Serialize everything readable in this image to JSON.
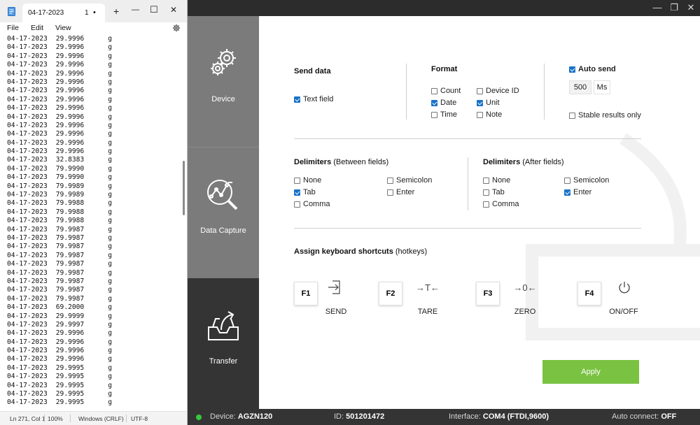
{
  "notepad": {
    "tab_title": "04-17-2023",
    "tab_number": "1",
    "tab_dot": "•",
    "new_tab": "+",
    "window_controls": {
      "minimize": "—",
      "maximize": "☐",
      "close": "✕"
    },
    "menu": {
      "file": "File",
      "edit": "Edit",
      "view": "View"
    },
    "settings_icon": "gear-icon",
    "lines": [
      [
        "04-17-2023",
        "29.9996",
        "g"
      ],
      [
        "04-17-2023",
        "29.9996",
        "g"
      ],
      [
        "04-17-2023",
        "29.9996",
        "g"
      ],
      [
        "04-17-2023",
        "29.9996",
        "g"
      ],
      [
        "04-17-2023",
        "29.9996",
        "g"
      ],
      [
        "04-17-2023",
        "29.9996",
        "g"
      ],
      [
        "04-17-2023",
        "29.9996",
        "g"
      ],
      [
        "04-17-2023",
        "29.9996",
        "g"
      ],
      [
        "04-17-2023",
        "29.9996",
        "g"
      ],
      [
        "04-17-2023",
        "29.9996",
        "g"
      ],
      [
        "04-17-2023",
        "29.9996",
        "g"
      ],
      [
        "04-17-2023",
        "29.9996",
        "g"
      ],
      [
        "04-17-2023",
        "29.9996",
        "g"
      ],
      [
        "04-17-2023",
        "29.9996",
        "g"
      ],
      [
        "04-17-2023",
        "32.8383",
        "g"
      ],
      [
        "04-17-2023",
        "79.9990",
        "g"
      ],
      [
        "04-17-2023",
        "79.9990",
        "g"
      ],
      [
        "04-17-2023",
        "79.9989",
        "g"
      ],
      [
        "04-17-2023",
        "79.9989",
        "g"
      ],
      [
        "04-17-2023",
        "79.9988",
        "g"
      ],
      [
        "04-17-2023",
        "79.9988",
        "g"
      ],
      [
        "04-17-2023",
        "79.9988",
        "g"
      ],
      [
        "04-17-2023",
        "79.9987",
        "g"
      ],
      [
        "04-17-2023",
        "79.9987",
        "g"
      ],
      [
        "04-17-2023",
        "79.9987",
        "g"
      ],
      [
        "04-17-2023",
        "79.9987",
        "g"
      ],
      [
        "04-17-2023",
        "79.9987",
        "g"
      ],
      [
        "04-17-2023",
        "79.9987",
        "g"
      ],
      [
        "04-17-2023",
        "79.9987",
        "g"
      ],
      [
        "04-17-2023",
        "79.9987",
        "g"
      ],
      [
        "04-17-2023",
        "79.9987",
        "g"
      ],
      [
        "04-17-2023",
        "69.2000",
        "g"
      ],
      [
        "04-17-2023",
        "29.9999",
        "g"
      ],
      [
        "04-17-2023",
        "29.9997",
        "g"
      ],
      [
        "04-17-2023",
        "29.9996",
        "g"
      ],
      [
        "04-17-2023",
        "29.9996",
        "g"
      ],
      [
        "04-17-2023",
        "29.9996",
        "g"
      ],
      [
        "04-17-2023",
        "29.9996",
        "g"
      ],
      [
        "04-17-2023",
        "29.9995",
        "g"
      ],
      [
        "04-17-2023",
        "29.9995",
        "g"
      ],
      [
        "04-17-2023",
        "29.9995",
        "g"
      ],
      [
        "04-17-2023",
        "29.9995",
        "g"
      ],
      [
        "04-17-2023",
        "29.9995",
        "g"
      ]
    ],
    "status": {
      "position": "Ln 271, Col 1",
      "zoom": "100%",
      "line_ending": "Windows (CRLF)",
      "encoding": "UTF-8"
    }
  },
  "app": {
    "window_controls": {
      "minimize": "—",
      "maximize": "❐",
      "close": "✕"
    },
    "sidebar": [
      {
        "label": "Device",
        "icon": "gears-icon",
        "active": true
      },
      {
        "label": "Data Capture",
        "icon": "chart-magnifier-icon",
        "active": true
      },
      {
        "label": "Transfer",
        "icon": "tray-upload-icon",
        "active": false
      }
    ],
    "send_data": {
      "title": "Send data",
      "text_field": {
        "label": "Text field",
        "checked": true
      }
    },
    "format": {
      "title": "Format",
      "options": [
        {
          "label": "Count",
          "checked": false
        },
        {
          "label": "Date",
          "checked": true
        },
        {
          "label": "Time",
          "checked": false
        },
        {
          "label": "Device ID",
          "checked": false
        },
        {
          "label": "Unit",
          "checked": true
        },
        {
          "label": "Note",
          "checked": false
        }
      ]
    },
    "auto_send": {
      "label": "Auto send",
      "checked": true,
      "value": "500",
      "unit": "Ms",
      "stable_only": {
        "label": "Stable results only",
        "checked": false
      }
    },
    "delimiters_between": {
      "title": "Delimiters",
      "subtitle": "(Between fields)",
      "options": [
        {
          "label": "None",
          "checked": false
        },
        {
          "label": "Tab",
          "checked": true
        },
        {
          "label": "Comma",
          "checked": false
        },
        {
          "label": "Semicolon",
          "checked": false
        },
        {
          "label": "Enter",
          "checked": false
        }
      ]
    },
    "delimiters_after": {
      "title": "Delimiters",
      "subtitle": "(After fields)",
      "options": [
        {
          "label": "None",
          "checked": false
        },
        {
          "label": "Tab",
          "checked": false
        },
        {
          "label": "Comma",
          "checked": false
        },
        {
          "label": "Semicolon",
          "checked": false
        },
        {
          "label": "Enter",
          "checked": true
        }
      ]
    },
    "shortcuts": {
      "title": "Assign keyboard shortcuts",
      "subtitle": "(hotkeys)",
      "items": [
        {
          "key": "F1",
          "icon": "send-icon",
          "glyph": "⇥",
          "label": "SEND"
        },
        {
          "key": "F2",
          "icon": "tare-icon",
          "glyph": "→T←",
          "label": "TARE"
        },
        {
          "key": "F3",
          "icon": "zero-icon",
          "glyph": "→0←",
          "label": "ZERO"
        },
        {
          "key": "F4",
          "icon": "power-icon",
          "glyph": "⏻",
          "label": "ON/OFF"
        }
      ]
    },
    "apply_label": "Apply",
    "status": {
      "device_label": "Device:",
      "device_value": "AGZN120",
      "id_label": "ID:",
      "id_value": "501201472",
      "interface_label": "Interface:",
      "interface_value": "COM4 (FTDI,9600)",
      "auto_connect_label": "Auto connect:",
      "auto_connect_value": "OFF",
      "connected_color": "#36c93b"
    }
  }
}
